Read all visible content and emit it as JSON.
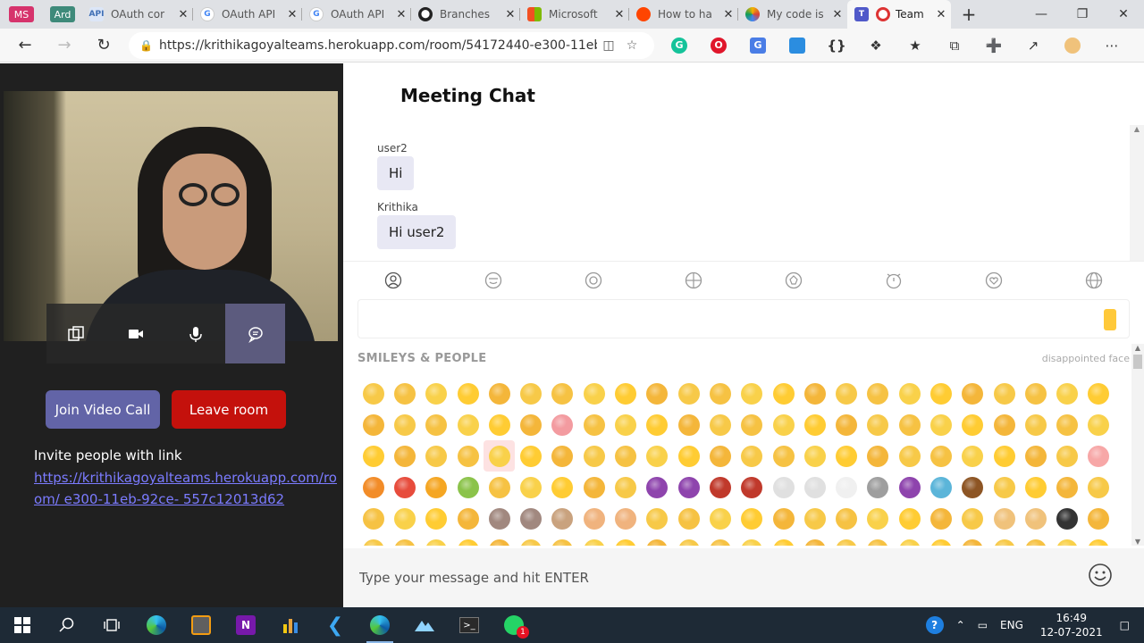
{
  "browser": {
    "tabs": [
      {
        "label": "",
        "badge": "MS"
      },
      {
        "label": "",
        "badge": "Ard"
      },
      {
        "label": "OAuth cor",
        "favicon": "api-icon"
      },
      {
        "label": "OAuth API",
        "favicon": "google-icon"
      },
      {
        "label": "OAuth API",
        "favicon": "google-icon"
      },
      {
        "label": "Branches",
        "favicon": "github-icon"
      },
      {
        "label": "Microsoft",
        "favicon": "microsoft-icon"
      },
      {
        "label": "How to ha",
        "favicon": "reddit-icon"
      },
      {
        "label": "My code is",
        "favicon": "colorful-icon"
      },
      {
        "label": "Team",
        "favicon": "teams-icon",
        "active": true
      }
    ],
    "url": "https://krithikagoyalteams.herokuapp.com/room/54172440-e300-11eb-...",
    "new_tab_symbol": "+",
    "close_symbol": "✕"
  },
  "video_panel": {
    "join_label": "Join Video Call",
    "leave_label": "Leave room",
    "invite_title": "Invite people with link",
    "invite_link": "https://krithikagoyalteams.herokuapp.com/room/54172440-e300-11eb-92ce-557c12013d62",
    "invite_link_shown": "https://krithikagoyalteams.herokuapp.com/room/ e300-11eb-92ce- 557c12013d62"
  },
  "chat": {
    "title": "Meeting Chat",
    "messages": [
      {
        "sender": "user2",
        "text": "Hi"
      },
      {
        "sender": "Krithika",
        "text": "Hi user2"
      }
    ],
    "input_placeholder": "Type your message and hit ENTER"
  },
  "emoji_picker": {
    "section_title": "SMILEYS & PEOPLE",
    "preview_name": "disappointed face",
    "categories": [
      "people-icon",
      "nature-icon",
      "food-icon",
      "activity-icon",
      "places-icon",
      "objects-icon",
      "symbols-icon",
      "flags-icon"
    ]
  },
  "taskbar": {
    "time": "16:49",
    "date": "12-07-2021",
    "lang": "ENG"
  },
  "colors": {
    "teams_purple": "#6264a7",
    "leave_red": "#c4110c",
    "link_blue": "#7b7bff"
  }
}
